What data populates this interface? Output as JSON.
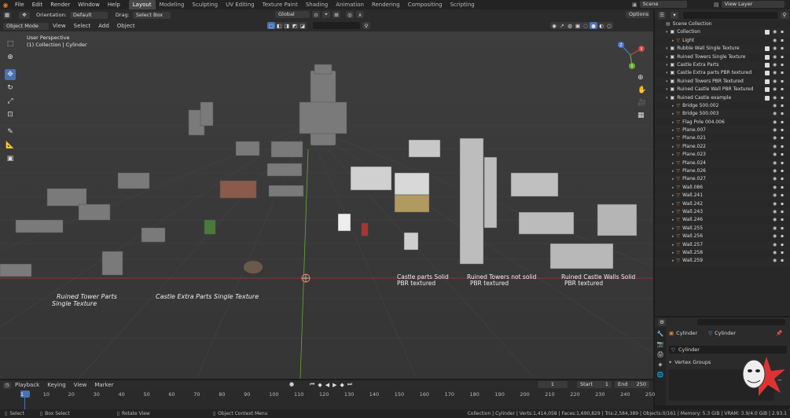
{
  "menu": {
    "items": [
      "File",
      "Edit",
      "Render",
      "Window",
      "Help"
    ],
    "workspaces": [
      "Layout",
      "Modeling",
      "Sculpting",
      "UV Editing",
      "Texture Paint",
      "Shading",
      "Animation",
      "Rendering",
      "Compositing",
      "Scripting"
    ],
    "active_workspace": "Layout",
    "scene": "Scene",
    "view_layer": "View Layer"
  },
  "tool_header": {
    "orientation_label": "Orientation:",
    "orientation_value": "Default",
    "drag_label": "Drag:",
    "drag_value": "Select Box",
    "transform_orientation": "Global",
    "options_label": "Options"
  },
  "view_header": {
    "mode": "Object Mode",
    "menus": [
      "View",
      "Select",
      "Add",
      "Object"
    ]
  },
  "viewport": {
    "perspective": "User Perspective",
    "collection_info": "(1) Collection | Cylinder",
    "labels": [
      "Ruined Tower Parts",
      "Single Texture",
      "Castle Extra Parts  Single Texture",
      "Castle parts Solid",
      "PBR textured",
      "Ruined Towers not solid",
      "PBR textured",
      "Ruined Castle Walls Solid",
      "PBR textured"
    ],
    "gizmo_axes": [
      "Z",
      "Y",
      "X"
    ]
  },
  "outliner": {
    "root": "Scene Collection",
    "rows": [
      {
        "name": "Collection",
        "indent": 1
      },
      {
        "name": "Light",
        "indent": 2
      },
      {
        "name": "Rubble Wall Single Texture",
        "indent": 1
      },
      {
        "name": "Ruined Towers Single Texture",
        "indent": 1
      },
      {
        "name": "Castle Extra Parts",
        "indent": 1
      },
      {
        "name": "Castle Extra parts PBR textured",
        "indent": 1
      },
      {
        "name": "Ruined Towers PBR Textured",
        "indent": 1
      },
      {
        "name": "Ruined Castle Wall PBR Textured",
        "indent": 1
      },
      {
        "name": "Ruined Castle example",
        "indent": 1
      },
      {
        "name": "Bridge 500.002",
        "indent": 2
      },
      {
        "name": "Bridge 500.003",
        "indent": 2
      },
      {
        "name": "Flag Pole 004.006",
        "indent": 2
      },
      {
        "name": "Plane.007",
        "indent": 2
      },
      {
        "name": "Plane.021",
        "indent": 2
      },
      {
        "name": "Plane.022",
        "indent": 2
      },
      {
        "name": "Plane.023",
        "indent": 2
      },
      {
        "name": "Plane.024",
        "indent": 2
      },
      {
        "name": "Plane.026",
        "indent": 2
      },
      {
        "name": "Plane.027",
        "indent": 2
      },
      {
        "name": "Wall.086",
        "indent": 2
      },
      {
        "name": "Wall.241",
        "indent": 2
      },
      {
        "name": "Wall.242",
        "indent": 2
      },
      {
        "name": "Wall.243",
        "indent": 2
      },
      {
        "name": "Wall.246",
        "indent": 2
      },
      {
        "name": "Wall.255",
        "indent": 2
      },
      {
        "name": "Wall.256",
        "indent": 2
      },
      {
        "name": "Wall.257",
        "indent": 2
      },
      {
        "name": "Wall.258",
        "indent": 2
      },
      {
        "name": "Wall.259",
        "indent": 2
      }
    ]
  },
  "properties": {
    "object_name": "Cylinder",
    "data_name": "Cylinder",
    "mesh_field": "Cylinder",
    "section": "Vertex Groups"
  },
  "timeline": {
    "menus": [
      "Playback",
      "Keying",
      "View",
      "Marker"
    ],
    "current_frame": "1",
    "start_label": "Start",
    "start_value": "1",
    "end_label": "End",
    "end_value": "250",
    "ticks": [
      "1",
      "10",
      "20",
      "30",
      "40",
      "50",
      "60",
      "70",
      "80",
      "90",
      "100",
      "110",
      "120",
      "130",
      "140",
      "150",
      "160",
      "170",
      "180",
      "190",
      "200",
      "210",
      "220",
      "230",
      "240",
      "250"
    ]
  },
  "statusbar": {
    "select": "Select",
    "box_select": "Box Select",
    "rotate_view": "Rotate View",
    "context_menu": "Object Context Menu",
    "stats": "Collection | Cylinder | Verts:1,414,058 | Faces:1,690,829 | Tris:2,584,389 | Objects:0/161 | Memory: 5.3 GiB | VRAM: 3.9/4.0 GiB | 2.93.1"
  },
  "colors": {
    "accent": "#4772b3",
    "axis_red": "#b33a3a",
    "axis_green": "#5a9c2a",
    "orange": "#e0843c"
  }
}
